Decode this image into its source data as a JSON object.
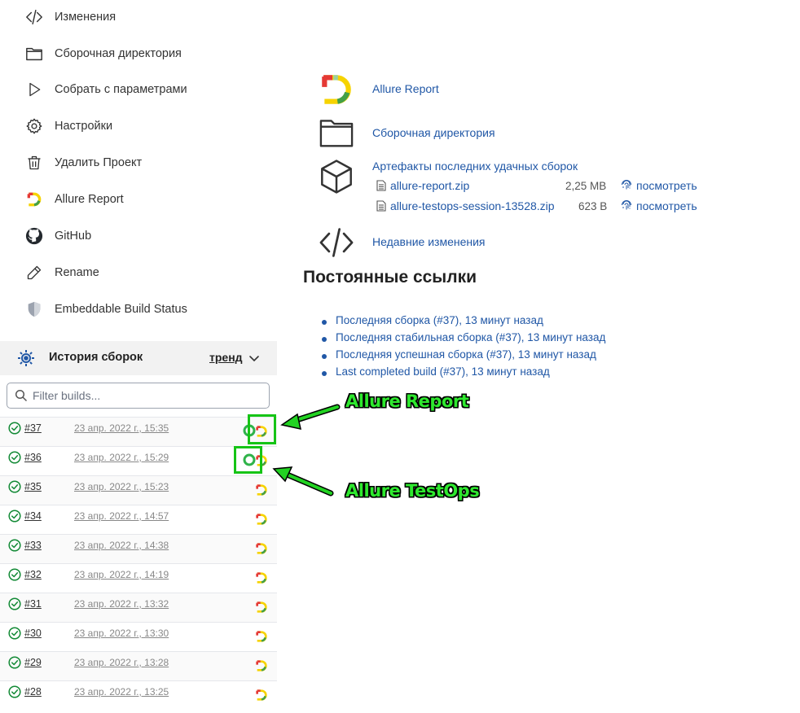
{
  "sidebar": {
    "items": [
      {
        "label": "Изменения",
        "icon": "code-icon"
      },
      {
        "label": "Сборочная директория",
        "icon": "folder-icon"
      },
      {
        "label": "Собрать с параметрами",
        "icon": "play-icon"
      },
      {
        "label": "Настройки",
        "icon": "gear-icon"
      },
      {
        "label": "Удалить Проект",
        "icon": "trash-icon"
      },
      {
        "label": "Allure Report",
        "icon": "allure-logo-icon"
      },
      {
        "label": "GitHub",
        "icon": "github-icon"
      },
      {
        "label": "Rename",
        "icon": "pencil-icon"
      },
      {
        "label": "Embeddable Build Status",
        "icon": "shield-icon"
      }
    ]
  },
  "history": {
    "title": "История сборок",
    "trend": "тренд",
    "filter_placeholder": "Filter builds...",
    "builds": [
      {
        "number": "#37",
        "date": "23 апр. 2022 г., 15:35",
        "status": "success",
        "testops": true
      },
      {
        "number": "#36",
        "date": "23 апр. 2022 г., 15:29",
        "status": "success",
        "testops": true
      },
      {
        "number": "#35",
        "date": "23 апр. 2022 г., 15:23",
        "status": "success",
        "testops": false
      },
      {
        "number": "#34",
        "date": "23 апр. 2022 г., 14:57",
        "status": "success",
        "testops": false
      },
      {
        "number": "#33",
        "date": "23 апр. 2022 г., 14:38",
        "status": "success",
        "testops": false
      },
      {
        "number": "#32",
        "date": "23 апр. 2022 г., 14:19",
        "status": "success",
        "testops": false
      },
      {
        "number": "#31",
        "date": "23 апр. 2022 г., 13:32",
        "status": "success",
        "testops": false
      },
      {
        "number": "#30",
        "date": "23 апр. 2022 г., 13:30",
        "status": "success",
        "testops": false
      },
      {
        "number": "#29",
        "date": "23 апр. 2022 г., 13:28",
        "status": "success",
        "testops": false
      },
      {
        "number": "#28",
        "date": "23 апр. 2022 г., 13:25",
        "status": "success",
        "testops": false
      }
    ]
  },
  "main": {
    "allure_report": "Allure Report",
    "build_dir": "Сборочная директория",
    "artifacts_title": "Артефакты последних удачных сборок",
    "artifacts": [
      {
        "name": "allure-report.zip",
        "size": "2,25 MB",
        "view": "посмотреть"
      },
      {
        "name": "allure-testops-session-13528.zip",
        "size": "623 B",
        "view": "посмотреть"
      }
    ],
    "recent_changes": "Недавние изменения",
    "permalinks_title": "Постоянные ссылки",
    "permalinks": [
      "Последняя сборка (#37), 13 минут назад",
      "Последняя стабильная сборка (#37), 13 минут назад",
      "Последняя успешная сборка (#37), 13 минут назад",
      "Last completed build (#37), 13 минут назад"
    ]
  },
  "annotations": {
    "allure_report": "Allure Report",
    "allure_testops": "Allure TestOps"
  },
  "colors": {
    "link": "#2057a6",
    "success": "#138a36",
    "annotation": "#16c416"
  }
}
